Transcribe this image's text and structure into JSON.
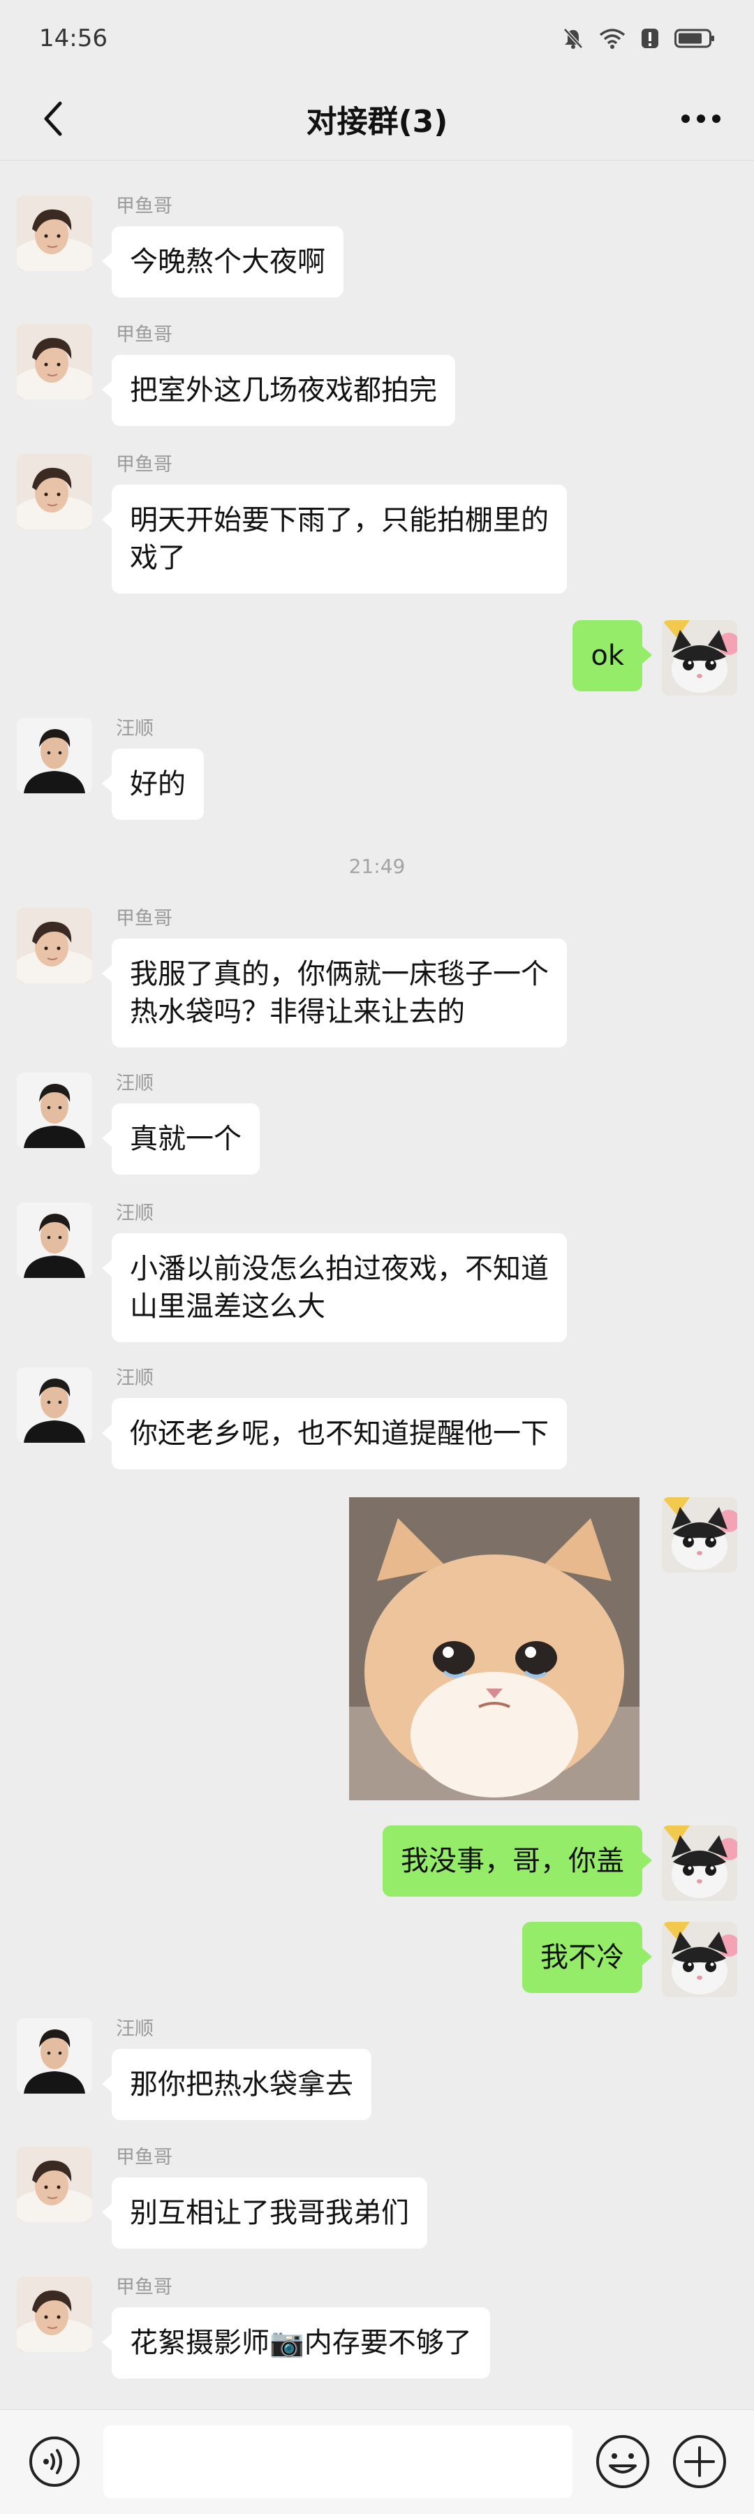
{
  "status_bar": {
    "time": "14:56",
    "battery_icon": "battery-icon"
  },
  "header": {
    "title": "对接群(3)"
  },
  "timestamp": "21:49",
  "senders": {
    "jia": "甲鱼哥",
    "wang": "汪顺"
  },
  "messages": [
    {
      "text": "今晚熬个大夜啊"
    },
    {
      "text": "把室外这几场夜戏都拍完"
    },
    {
      "text": "明天开始要下雨了，只能拍棚里的\n戏了"
    },
    {
      "text": "ok"
    },
    {
      "text": "好的"
    },
    {
      "text": "我服了真的，你俩就一床毯子一个\n热水袋吗？非得让来让去的"
    },
    {
      "text": "真就一个"
    },
    {
      "text": "小潘以前没怎么拍过夜戏，不知道\n山里温差这么大"
    },
    {
      "text": "你还老乡呢，也不知道提醒他一下"
    },
    {
      "text": "sad-cat-sticker"
    },
    {
      "text": "我没事，哥，你盖"
    },
    {
      "text": "我不冷"
    },
    {
      "text": "那你把热水袋拿去"
    },
    {
      "text": "别互相让了我哥我弟们"
    },
    {
      "text": "花絮摄影师📷内存要不够了"
    }
  ],
  "bottom_bar": {
    "input_value": ""
  },
  "colors": {
    "bubble_self": "#95ec69",
    "bubble_other": "#ffffff",
    "background": "#ededed"
  }
}
